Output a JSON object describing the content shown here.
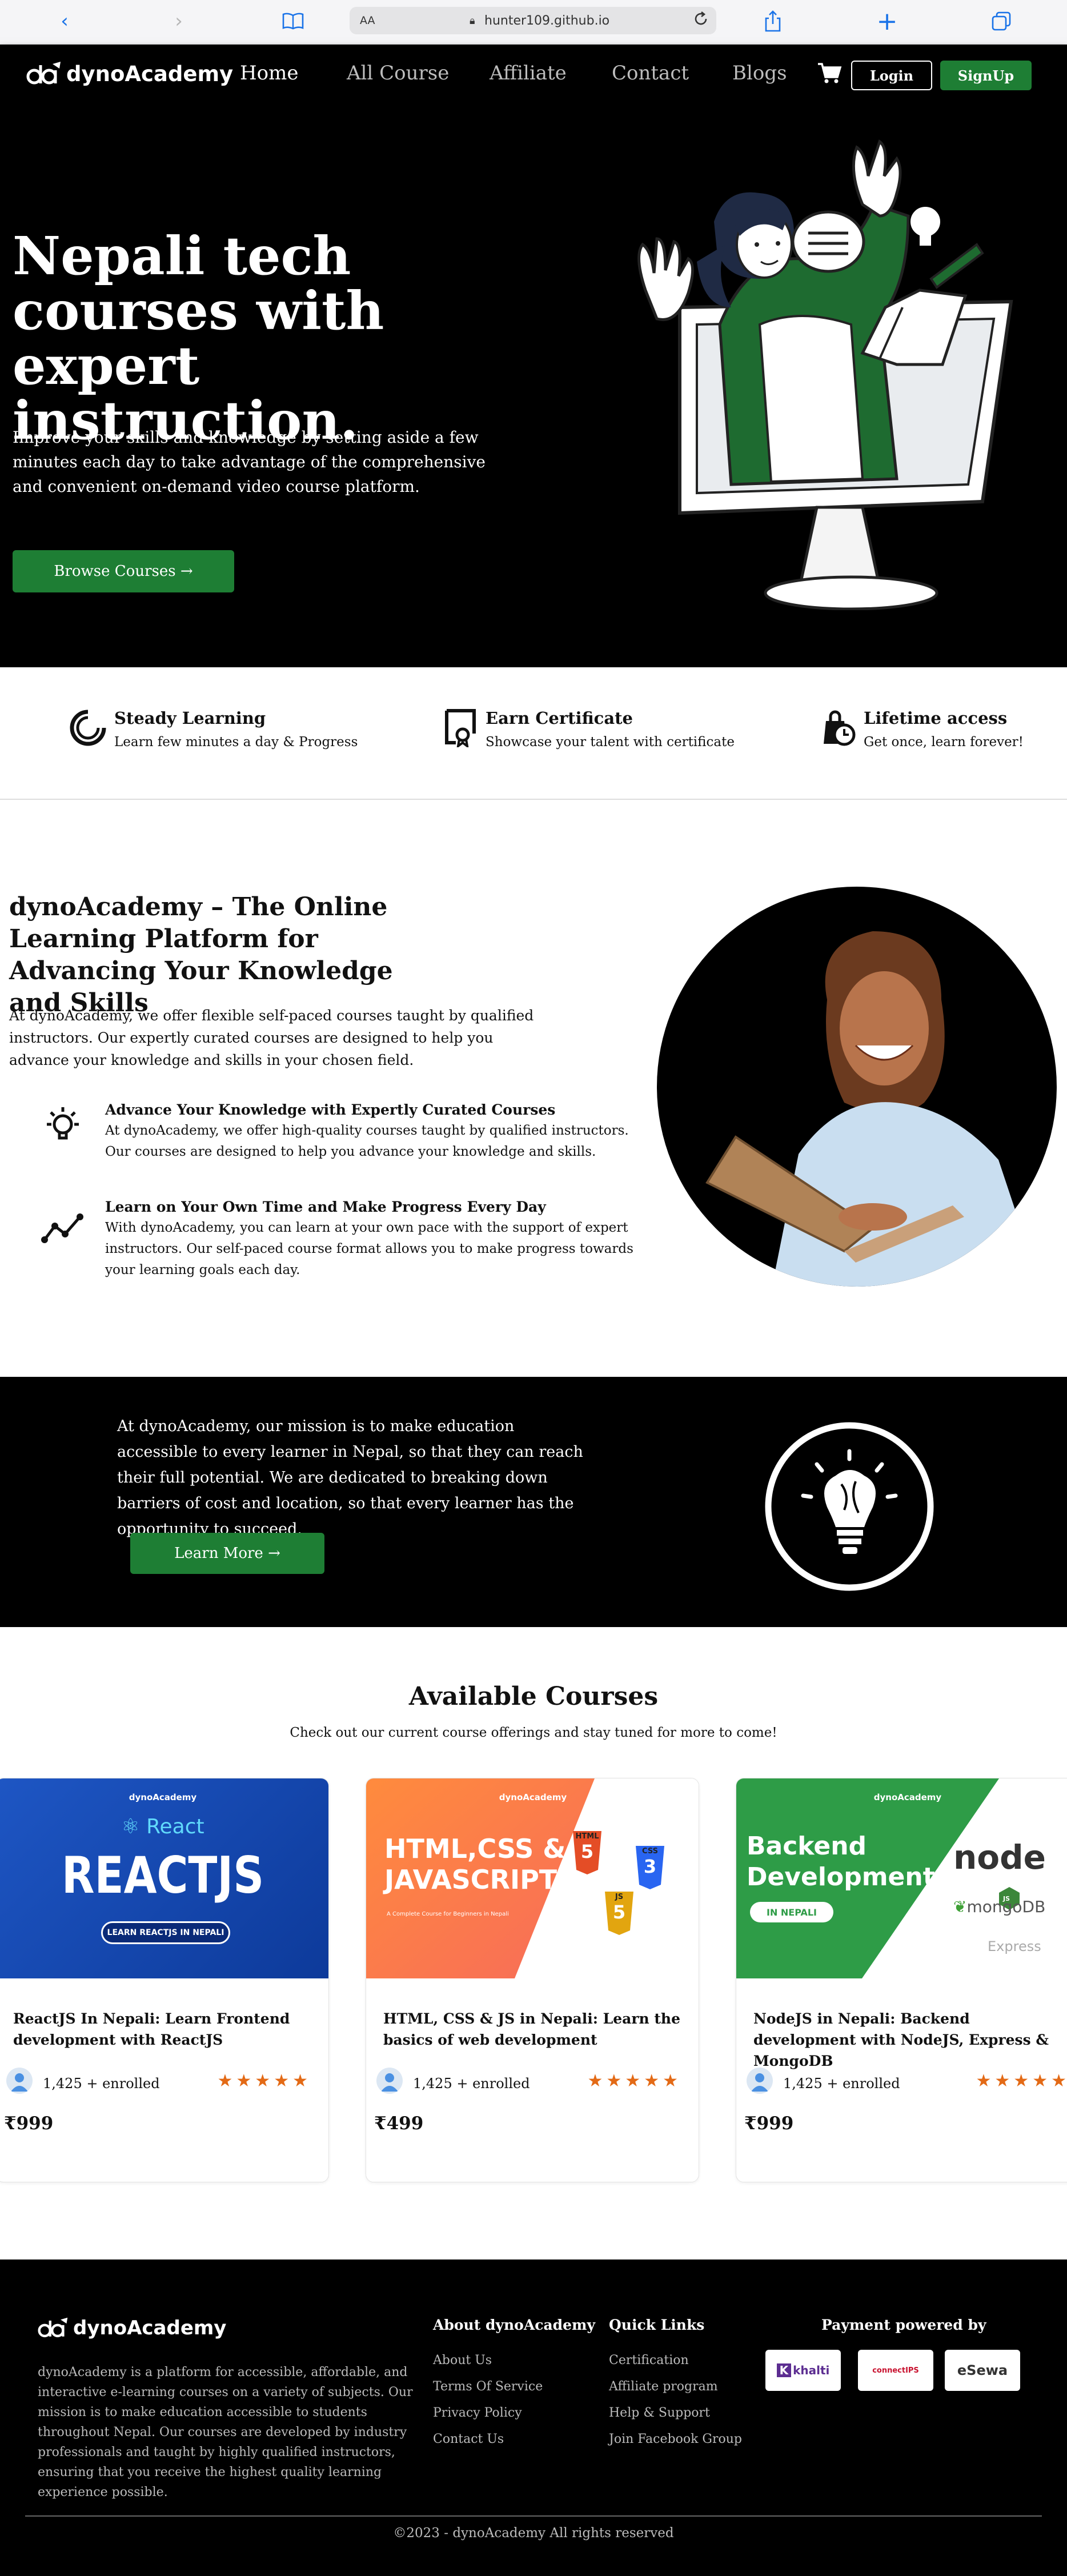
{
  "browser": {
    "text_size_label": "AA",
    "url": "hunter109.github.io"
  },
  "nav": {
    "brand": "dynoAcademy",
    "links": [
      "Home",
      "All Course",
      "Affiliate",
      "Contact",
      "Blogs"
    ],
    "login_label": "Login",
    "signup_label": "SignUp"
  },
  "hero": {
    "title": "Nepali tech courses with expert instruction.",
    "description": "Improve your skills and knowledge by setting aside a few minutes each day to take advantage of the comprehensive and convenient on-demand video course platform.",
    "cta_label": "Browse Courses",
    "cta_arrow": "→"
  },
  "features": [
    {
      "title": "Steady Learning",
      "subtitle": "Learn few minutes a day & Progress",
      "icon": "progress-spinner-icon"
    },
    {
      "title": "Earn Certificate",
      "subtitle": "Showcase your talent with certificate",
      "icon": "certificate-icon"
    },
    {
      "title": "Lifetime access",
      "subtitle": "Get once, learn forever!",
      "icon": "clock-bag-icon"
    }
  ],
  "about": {
    "title": "dynoAcademy – The Online Learning Platform for Advancing Your Knowledge and Skills",
    "description": "At dynoAcademy, we offer flexible self-paced courses taught by qualified instructors. Our expertly curated courses are designed to help you advance your knowledge and skills in your chosen field.",
    "points": [
      {
        "title": "Advance Your Knowledge with Expertly Curated Courses",
        "text": "At dynoAcademy, we offer high-quality courses taught by qualified instructors. Our courses are designed to help you advance your knowledge and skills.",
        "icon": "lightbulb-icon"
      },
      {
        "title": "Learn on Your Own Time and Make Progress Every Day",
        "text": "With dynoAcademy, you can learn at your own pace with the support of expert instructors. Our self-paced course format allows you to make progress towards your learning goals each day.",
        "icon": "trend-line-icon"
      }
    ]
  },
  "mission": {
    "text": "At dynoAcademy, our mission is to make education accessible to every learner in Nepal, so that they can reach their full potential. We are dedicated to breaking down barriers of cost and location, so that every learner has the opportunity to succeed.",
    "cta_label": "Learn More",
    "cta_arrow": "→"
  },
  "courses": {
    "title": "Available Courses",
    "subtitle": "Check out our current course offerings and stay tuned for more to come!",
    "items": [
      {
        "title": "ReactJS In Nepali: Learn Frontend development with ReactJS",
        "enrolled": "1,425 + enrolled",
        "price": "999",
        "rating": 5,
        "thumb": {
          "brand": "dynoAcademy",
          "small": "React",
          "big": "REACTJS",
          "badge": "LEARN REACTJS IN NEPALI"
        }
      },
      {
        "title": "HTML, CSS & JS in Nepali: Learn the basics of web development",
        "enrolled": "1,425 + enrolled",
        "price": "499",
        "rating": 5,
        "thumb": {
          "brand": "dynoAcademy",
          "line1": "HTML,CSS &",
          "line2": "JAVASCRIPT",
          "tagline": "A Complete Course for Beginners in Nepali",
          "html": "HTML",
          "css": "CSS",
          "js": "JS",
          "html_num": "5",
          "css_num": "3",
          "js_num": "5"
        }
      },
      {
        "title": "NodeJS in Nepali: Backend development with NodeJS, Express & MongoDB",
        "enrolled": "1,425 + enrolled",
        "price": "999",
        "rating": 5,
        "thumb": {
          "brand": "dynoAcademy",
          "line1": "Backend",
          "line2": "Development",
          "badge": "IN NEPALI",
          "node": "node",
          "mongo": "mongoDB",
          "express": "Express",
          "js": "JS"
        }
      }
    ],
    "currency_symbol": "₹",
    "star": "★"
  },
  "footer": {
    "brand": "dynoAcademy",
    "description": "dynoAcademy is a platform for accessible, affordable, and interactive e-learning courses on a variety of subjects. Our mission is to make education accessible to students throughout Nepal. Our courses are developed by industry professionals and taught by highly qualified instructors, ensuring that you receive the highest quality learning experience possible.",
    "about_heading": "About dynoAcademy",
    "about_links": [
      "About Us",
      "Terms Of Service",
      "Privacy Policy",
      "Contact Us"
    ],
    "quick_heading": "Quick Links",
    "quick_links": [
      "Certification",
      "Affiliate program",
      "Help & Support",
      "Join Facebook Group"
    ],
    "payment_heading": "Payment powered by",
    "payments": [
      "khalti",
      "connectIPS",
      "eSewa"
    ],
    "copyright": "©2023 - dynoAcademy All rights reserved"
  },
  "colors": {
    "accent_green": "#1e7e34",
    "star_orange": "#e36a16",
    "black": "#000000"
  }
}
